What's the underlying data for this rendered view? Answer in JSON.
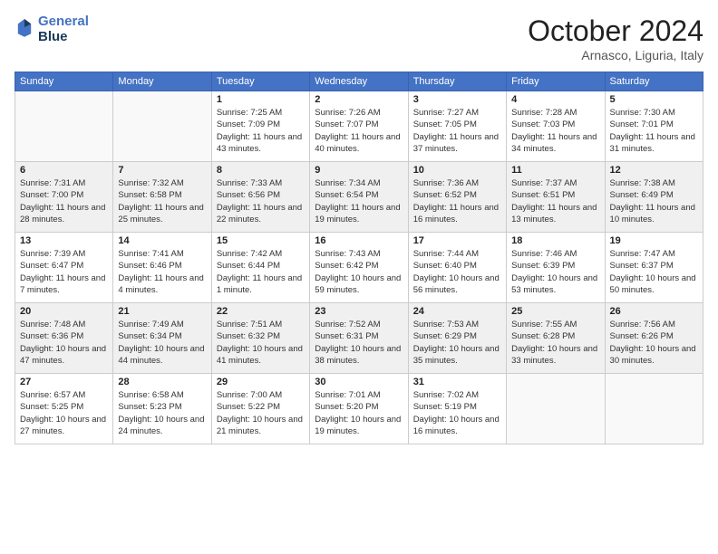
{
  "header": {
    "logo_line1": "General",
    "logo_line2": "Blue",
    "month": "October 2024",
    "location": "Arnasco, Liguria, Italy"
  },
  "days_of_week": [
    "Sunday",
    "Monday",
    "Tuesday",
    "Wednesday",
    "Thursday",
    "Friday",
    "Saturday"
  ],
  "weeks": [
    [
      {
        "day": "",
        "info": ""
      },
      {
        "day": "",
        "info": ""
      },
      {
        "day": "1",
        "info": "Sunrise: 7:25 AM\nSunset: 7:09 PM\nDaylight: 11 hours and 43 minutes."
      },
      {
        "day": "2",
        "info": "Sunrise: 7:26 AM\nSunset: 7:07 PM\nDaylight: 11 hours and 40 minutes."
      },
      {
        "day": "3",
        "info": "Sunrise: 7:27 AM\nSunset: 7:05 PM\nDaylight: 11 hours and 37 minutes."
      },
      {
        "day": "4",
        "info": "Sunrise: 7:28 AM\nSunset: 7:03 PM\nDaylight: 11 hours and 34 minutes."
      },
      {
        "day": "5",
        "info": "Sunrise: 7:30 AM\nSunset: 7:01 PM\nDaylight: 11 hours and 31 minutes."
      }
    ],
    [
      {
        "day": "6",
        "info": "Sunrise: 7:31 AM\nSunset: 7:00 PM\nDaylight: 11 hours and 28 minutes."
      },
      {
        "day": "7",
        "info": "Sunrise: 7:32 AM\nSunset: 6:58 PM\nDaylight: 11 hours and 25 minutes."
      },
      {
        "day": "8",
        "info": "Sunrise: 7:33 AM\nSunset: 6:56 PM\nDaylight: 11 hours and 22 minutes."
      },
      {
        "day": "9",
        "info": "Sunrise: 7:34 AM\nSunset: 6:54 PM\nDaylight: 11 hours and 19 minutes."
      },
      {
        "day": "10",
        "info": "Sunrise: 7:36 AM\nSunset: 6:52 PM\nDaylight: 11 hours and 16 minutes."
      },
      {
        "day": "11",
        "info": "Sunrise: 7:37 AM\nSunset: 6:51 PM\nDaylight: 11 hours and 13 minutes."
      },
      {
        "day": "12",
        "info": "Sunrise: 7:38 AM\nSunset: 6:49 PM\nDaylight: 11 hours and 10 minutes."
      }
    ],
    [
      {
        "day": "13",
        "info": "Sunrise: 7:39 AM\nSunset: 6:47 PM\nDaylight: 11 hours and 7 minutes."
      },
      {
        "day": "14",
        "info": "Sunrise: 7:41 AM\nSunset: 6:46 PM\nDaylight: 11 hours and 4 minutes."
      },
      {
        "day": "15",
        "info": "Sunrise: 7:42 AM\nSunset: 6:44 PM\nDaylight: 11 hours and 1 minute."
      },
      {
        "day": "16",
        "info": "Sunrise: 7:43 AM\nSunset: 6:42 PM\nDaylight: 10 hours and 59 minutes."
      },
      {
        "day": "17",
        "info": "Sunrise: 7:44 AM\nSunset: 6:40 PM\nDaylight: 10 hours and 56 minutes."
      },
      {
        "day": "18",
        "info": "Sunrise: 7:46 AM\nSunset: 6:39 PM\nDaylight: 10 hours and 53 minutes."
      },
      {
        "day": "19",
        "info": "Sunrise: 7:47 AM\nSunset: 6:37 PM\nDaylight: 10 hours and 50 minutes."
      }
    ],
    [
      {
        "day": "20",
        "info": "Sunrise: 7:48 AM\nSunset: 6:36 PM\nDaylight: 10 hours and 47 minutes."
      },
      {
        "day": "21",
        "info": "Sunrise: 7:49 AM\nSunset: 6:34 PM\nDaylight: 10 hours and 44 minutes."
      },
      {
        "day": "22",
        "info": "Sunrise: 7:51 AM\nSunset: 6:32 PM\nDaylight: 10 hours and 41 minutes."
      },
      {
        "day": "23",
        "info": "Sunrise: 7:52 AM\nSunset: 6:31 PM\nDaylight: 10 hours and 38 minutes."
      },
      {
        "day": "24",
        "info": "Sunrise: 7:53 AM\nSunset: 6:29 PM\nDaylight: 10 hours and 35 minutes."
      },
      {
        "day": "25",
        "info": "Sunrise: 7:55 AM\nSunset: 6:28 PM\nDaylight: 10 hours and 33 minutes."
      },
      {
        "day": "26",
        "info": "Sunrise: 7:56 AM\nSunset: 6:26 PM\nDaylight: 10 hours and 30 minutes."
      }
    ],
    [
      {
        "day": "27",
        "info": "Sunrise: 6:57 AM\nSunset: 5:25 PM\nDaylight: 10 hours and 27 minutes."
      },
      {
        "day": "28",
        "info": "Sunrise: 6:58 AM\nSunset: 5:23 PM\nDaylight: 10 hours and 24 minutes."
      },
      {
        "day": "29",
        "info": "Sunrise: 7:00 AM\nSunset: 5:22 PM\nDaylight: 10 hours and 21 minutes."
      },
      {
        "day": "30",
        "info": "Sunrise: 7:01 AM\nSunset: 5:20 PM\nDaylight: 10 hours and 19 minutes."
      },
      {
        "day": "31",
        "info": "Sunrise: 7:02 AM\nSunset: 5:19 PM\nDaylight: 10 hours and 16 minutes."
      },
      {
        "day": "",
        "info": ""
      },
      {
        "day": "",
        "info": ""
      }
    ]
  ]
}
